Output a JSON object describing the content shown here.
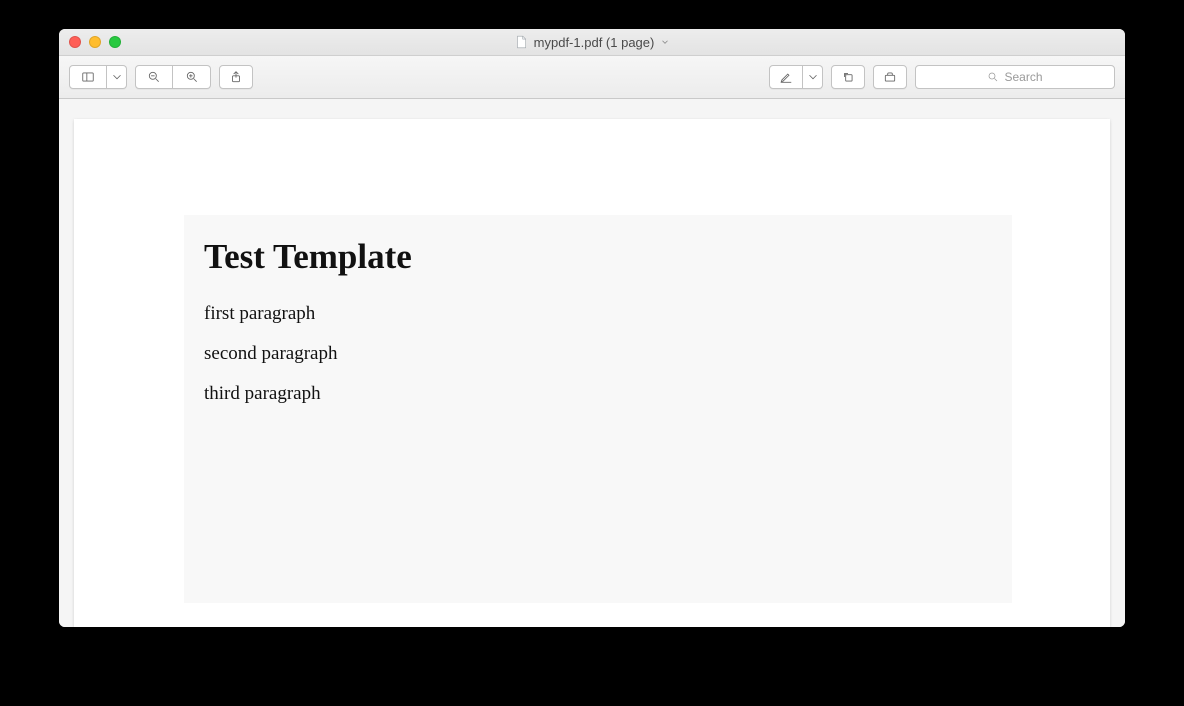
{
  "window": {
    "title": "mypdf-1.pdf (1 page)"
  },
  "toolbar": {
    "search_placeholder": "Search"
  },
  "document": {
    "title": "Test Template",
    "paragraphs": [
      "first paragraph",
      "second paragraph",
      "third paragraph"
    ]
  }
}
